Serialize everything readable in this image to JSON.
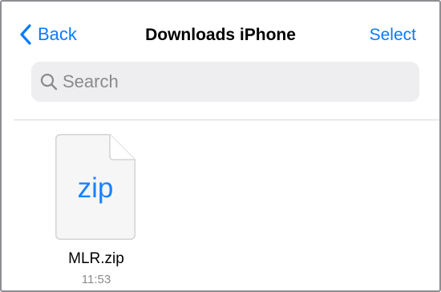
{
  "navbar": {
    "back_label": "Back",
    "title": "Downloads iPhone",
    "select_label": "Select"
  },
  "search": {
    "placeholder": "Search",
    "value": ""
  },
  "files": [
    {
      "extension": "zip",
      "name": "MLR.zip",
      "time": "11:53",
      "icon": "document-icon"
    }
  ],
  "colors": {
    "accent": "#0a7aff",
    "search_background": "#eeeef0",
    "secondary_text": "#8a8a8e"
  }
}
